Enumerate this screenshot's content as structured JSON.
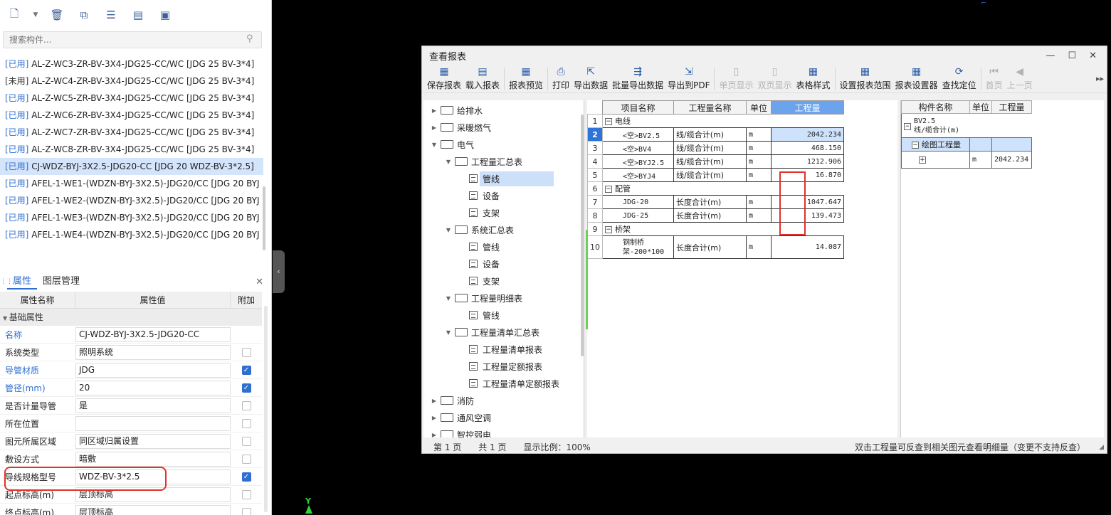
{
  "left_toolbar": {
    "icons": [
      "new-icon",
      "dropdown-arrow-icon",
      "delete-icon",
      "copy-icon",
      "column-icon",
      "filter-icon",
      "filter-check-icon"
    ]
  },
  "search": {
    "placeholder": "搜索构件..."
  },
  "component_list": [
    {
      "tag": "[已用]",
      "name": "AL-Z-WC3-ZR-BV-3X4-JDG25-CC/WC [JDG 25 BV-3*4]",
      "used": true
    },
    {
      "tag": "[未用]",
      "name": "AL-Z-WC4-ZR-BV-3X4-JDG25-CC/WC [JDG 25 BV-3*4]",
      "used": false
    },
    {
      "tag": "[已用]",
      "name": "AL-Z-WC5-ZR-BV-3X4-JDG25-CC/WC [JDG 25 BV-3*4]",
      "used": true
    },
    {
      "tag": "[已用]",
      "name": "AL-Z-WC6-ZR-BV-3X4-JDG25-CC/WC [JDG 25 BV-3*4]",
      "used": true
    },
    {
      "tag": "[已用]",
      "name": "AL-Z-WC7-ZR-BV-3X4-JDG25-CC/WC [JDG 25 BV-3*4]",
      "used": true
    },
    {
      "tag": "[已用]",
      "name": "AL-Z-WC8-ZR-BV-3X4-JDG25-CC/WC [JDG 25 BV-3*4]",
      "used": true
    },
    {
      "tag": "[已用]",
      "name": "CJ-WDZ-BYJ-3X2.5-JDG20-CC [JDG 20 WDZ-BV-3*2.5]",
      "used": true,
      "selected": true
    },
    {
      "tag": "[已用]",
      "name": "AFEL-1-WE1-(WDZN-BYJ-3X2.5)-JDG20/CC [JDG 20 BYJ",
      "used": true
    },
    {
      "tag": "[已用]",
      "name": "AFEL-1-WE2-(WDZN-BYJ-3X2.5)-JDG20/CC [JDG 20 BYJ",
      "used": true
    },
    {
      "tag": "[已用]",
      "name": "AFEL-1-WE3-(WDZN-BYJ-3X2.5)-JDG20/CC [JDG 20 BYJ",
      "used": true
    },
    {
      "tag": "[已用]",
      "name": "AFEL-1-WE4-(WDZN-BYJ-3X2.5)-JDG20/CC [JDG 20 BYJ",
      "used": true
    }
  ],
  "panel_tabs": {
    "properties": "属性",
    "layers": "图层管理"
  },
  "prop_grid": {
    "headers": {
      "name": "属性名称",
      "value": "属性值",
      "extra": "附加"
    },
    "group": "基础属性",
    "rows": [
      {
        "name": "名称",
        "value": "CJ-WDZ-BYJ-3X2.5-JDG20-CC",
        "blue": true,
        "checkbox": false,
        "checked": false
      },
      {
        "name": "系统类型",
        "value": "照明系统",
        "blue": false,
        "checkbox": true,
        "checked": false
      },
      {
        "name": "导管材质",
        "value": "JDG",
        "blue": true,
        "checkbox": true,
        "checked": true
      },
      {
        "name": "管径(mm)",
        "value": "20",
        "blue": true,
        "checkbox": true,
        "checked": true
      },
      {
        "name": "是否计量导管",
        "value": "是",
        "blue": false,
        "checkbox": true,
        "checked": false
      },
      {
        "name": "所在位置",
        "value": "",
        "blue": false,
        "checkbox": true,
        "checked": false
      },
      {
        "name": "图元所属区域",
        "value": "同区域归属设置",
        "blue": false,
        "checkbox": true,
        "checked": false
      },
      {
        "name": "敷设方式",
        "value": "暗敷",
        "blue": false,
        "checkbox": true,
        "checked": false
      },
      {
        "name": "导线规格型号",
        "value": "WDZ-BV-3*2.5",
        "blue": false,
        "checkbox": true,
        "checked": true
      },
      {
        "name": "起点标高(m)",
        "value": "层顶标高",
        "blue": false,
        "checkbox": true,
        "checked": false
      },
      {
        "name": "终点标高(m)",
        "value": "层顶标高",
        "blue": false,
        "checkbox": true,
        "checked": false
      }
    ]
  },
  "canvas": {
    "axis_label": "Y"
  },
  "report_window": {
    "title": "查看报表",
    "toolbar": [
      {
        "label": "保存报表",
        "icon": "save-report-icon",
        "glyph": "▦",
        "disabled": false
      },
      {
        "label": "载入报表",
        "icon": "load-report-icon",
        "glyph": "▤",
        "disabled": false
      },
      {
        "sep": true
      },
      {
        "label": "报表预览",
        "icon": "preview-icon",
        "glyph": "▦",
        "disabled": false
      },
      {
        "sep": true
      },
      {
        "label": "打印",
        "icon": "print-icon",
        "glyph": "⎙",
        "disabled": false
      },
      {
        "label": "导出数据",
        "icon": "export-data-icon",
        "glyph": "⇱",
        "disabled": false
      },
      {
        "label": "批量导出数据",
        "icon": "batch-export-icon",
        "glyph": "⇶",
        "disabled": false
      },
      {
        "label": "导出到PDF",
        "icon": "export-pdf-icon",
        "glyph": "⇲",
        "disabled": false
      },
      {
        "sep": true
      },
      {
        "label": "单页显示",
        "icon": "single-page-icon",
        "glyph": "▯",
        "disabled": true
      },
      {
        "label": "双页显示",
        "icon": "double-page-icon",
        "glyph": "▯",
        "disabled": true
      },
      {
        "label": "表格样式",
        "icon": "table-style-icon",
        "glyph": "▦",
        "disabled": false
      },
      {
        "sep": true
      },
      {
        "label": "设置报表范围",
        "icon": "report-range-icon",
        "glyph": "▦",
        "disabled": false
      },
      {
        "label": "报表设置器",
        "icon": "report-settings-icon",
        "glyph": "▦",
        "disabled": false
      },
      {
        "label": "查找定位",
        "icon": "locate-icon",
        "glyph": "⟳",
        "disabled": false
      },
      {
        "sep": true
      },
      {
        "label": "首页",
        "icon": "first-page-icon",
        "glyph": "⏮",
        "disabled": true
      },
      {
        "label": "上一页",
        "icon": "prev-page-icon",
        "glyph": "◀",
        "disabled": true
      }
    ],
    "tree": [
      {
        "level": 0,
        "type": "folder",
        "expanded": false,
        "label": "给排水"
      },
      {
        "level": 0,
        "type": "folder",
        "expanded": false,
        "label": "采暖燃气"
      },
      {
        "level": 0,
        "type": "folder",
        "expanded": true,
        "label": "电气"
      },
      {
        "level": 1,
        "type": "folder",
        "expanded": true,
        "label": "工程量汇总表"
      },
      {
        "level": 2,
        "type": "doc",
        "label": "管线",
        "selected": true
      },
      {
        "level": 2,
        "type": "doc",
        "label": "设备"
      },
      {
        "level": 2,
        "type": "doc",
        "label": "支架"
      },
      {
        "level": 1,
        "type": "folder",
        "expanded": true,
        "label": "系统汇总表"
      },
      {
        "level": 2,
        "type": "doc",
        "label": "管线"
      },
      {
        "level": 2,
        "type": "doc",
        "label": "设备"
      },
      {
        "level": 2,
        "type": "doc",
        "label": "支架"
      },
      {
        "level": 1,
        "type": "folder",
        "expanded": true,
        "label": "工程量明细表"
      },
      {
        "level": 2,
        "type": "doc",
        "label": "管线"
      },
      {
        "level": 1,
        "type": "folder",
        "expanded": true,
        "label": "工程量清单汇总表"
      },
      {
        "level": 2,
        "type": "doc",
        "label": "工程量清单报表"
      },
      {
        "level": 2,
        "type": "doc",
        "label": "工程量定额报表"
      },
      {
        "level": 2,
        "type": "doc",
        "label": "工程量清单定额报表"
      },
      {
        "level": 0,
        "type": "folder",
        "expanded": false,
        "label": "消防"
      },
      {
        "level": 0,
        "type": "folder",
        "expanded": false,
        "label": "通风空调"
      },
      {
        "level": 0,
        "type": "folder",
        "expanded": false,
        "label": "智控弱电"
      }
    ],
    "report_grid": {
      "headers": [
        "项目名称",
        "工程量名称",
        "单位",
        "工程量"
      ],
      "rows": [
        {
          "n": "1",
          "group": true,
          "label": "电线"
        },
        {
          "n": "2",
          "item": "<空>BV2.5",
          "qname": "线/缆合计(m)",
          "unit": "m",
          "qty": "2042.234",
          "current": true
        },
        {
          "n": "3",
          "item": "<空>BV4",
          "qname": "线/缆合计(m)",
          "unit": "m",
          "qty": "468.150"
        },
        {
          "n": "4",
          "item": "<空>BYJ2.5",
          "qname": "线/缆合计(m)",
          "unit": "m",
          "qty": "1212.906"
        },
        {
          "n": "5",
          "item": "<空>BYJ4",
          "qname": "线/缆合计(m)",
          "unit": "m",
          "qty": "16.870"
        },
        {
          "n": "6",
          "group": true,
          "label": "配管"
        },
        {
          "n": "7",
          "item": "JDG-20",
          "qname": "长度合计(m)",
          "unit": "m",
          "qty": "1047.647"
        },
        {
          "n": "8",
          "item": "JDG-25",
          "qname": "长度合计(m)",
          "unit": "m",
          "qty": "139.473"
        },
        {
          "n": "9",
          "group": true,
          "label": "桥架"
        },
        {
          "n": "10",
          "item": "钢制桥架-200*100",
          "qname": "长度合计(m)",
          "unit": "m",
          "qty": "14.087",
          "tall": true
        }
      ]
    },
    "detail_grid": {
      "headers": [
        "构件名称",
        "单位",
        "工程量"
      ],
      "group_line1": "BV2.5",
      "group_line2": "线/缆合计(m)",
      "sub_label": "绘图工程量",
      "row": {
        "unit": "m",
        "qty": "2042.234"
      }
    },
    "status": {
      "page_label": "第 1 页",
      "total_label": "共 1 页",
      "zoom_label": "显示比例：100%",
      "hint": "双击工程量可反查到相关图元查看明细量（变更不支持反查）"
    }
  }
}
